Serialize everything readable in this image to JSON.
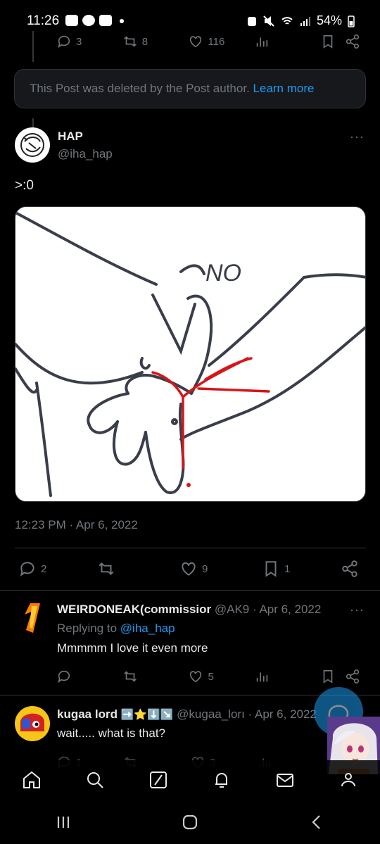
{
  "status_bar": {
    "time": "11:26",
    "battery": "54%"
  },
  "prev_tweet": {
    "replies": "3",
    "retweets": "8",
    "likes": "116"
  },
  "deleted_notice": {
    "text": "This Post was deleted by the Post author.",
    "link": "Learn more"
  },
  "main_tweet": {
    "name": "HAP",
    "handle": "@iha_hap",
    "text": ">:0",
    "drawing_text": "NO",
    "timestamp": "12:23 PM · Apr 6, 2022",
    "replies": "2",
    "likes": "9",
    "bookmarks": "1"
  },
  "reply1": {
    "name": "WEIRDONEAK(commissior",
    "handle": "@AK9",
    "date": "· Apr 6, 2022",
    "replying_prefix": "Replying to",
    "replying_handle": "@iha_hap",
    "text": "Mmmmm I love it even more",
    "likes": "5"
  },
  "reply2": {
    "name": "kugaa lord",
    "emojis": "➡️⭐⬇️↘️",
    "handle": "@kugaa_lorı",
    "date": "· Apr 6, 2022",
    "text": "wait..... what is that?",
    "replies": "1",
    "likes": "3"
  },
  "more_glyph": "···"
}
